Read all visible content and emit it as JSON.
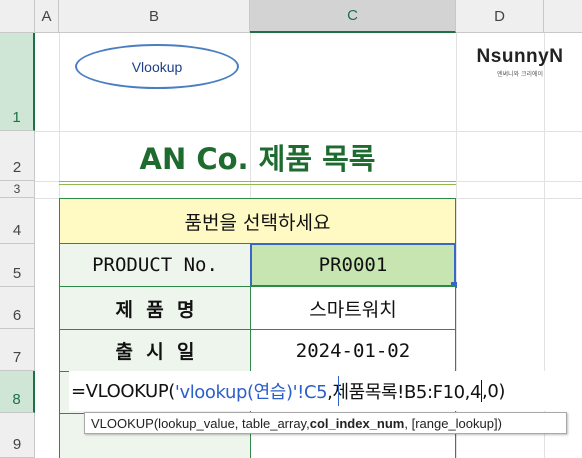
{
  "columns": [
    "A",
    "B",
    "C",
    "D"
  ],
  "rows": [
    "1",
    "2",
    "3",
    "4",
    "5",
    "6",
    "7",
    "8",
    "9"
  ],
  "shape_label": "Vlookup",
  "logo": {
    "text": "NsunnyN",
    "tagline": "엔써니와 크리에이"
  },
  "title": "AN Co. 제품 목록",
  "table": {
    "header": "품번을 선택하세요",
    "rows": [
      {
        "label": "PRODUCT No.",
        "value": "PR0001"
      },
      {
        "label": "제  품  명",
        "value": "스마트워치"
      },
      {
        "label": "출  시  일",
        "value": "2024-01-02"
      },
      {
        "label": "",
        "value": ""
      },
      {
        "label": "",
        "value": ""
      }
    ]
  },
  "formula": {
    "p1": "=VLOOKUP(",
    "p2": "'vlookup(연습)'!C5",
    "p3": ",제품목록!B5:F10,4",
    "p4": ",0)"
  },
  "tooltip": {
    "prefix": "VLOOKUP(lookup_value, table_array, ",
    "bold": "col_index_num",
    "suffix": ", [range_lookup])"
  },
  "colors": {
    "accent": "#1e7145",
    "cell_fill_header": "#fff9c4",
    "cell_fill_selected": "#c6e5b0",
    "label_fill": "#eef5ec"
  }
}
